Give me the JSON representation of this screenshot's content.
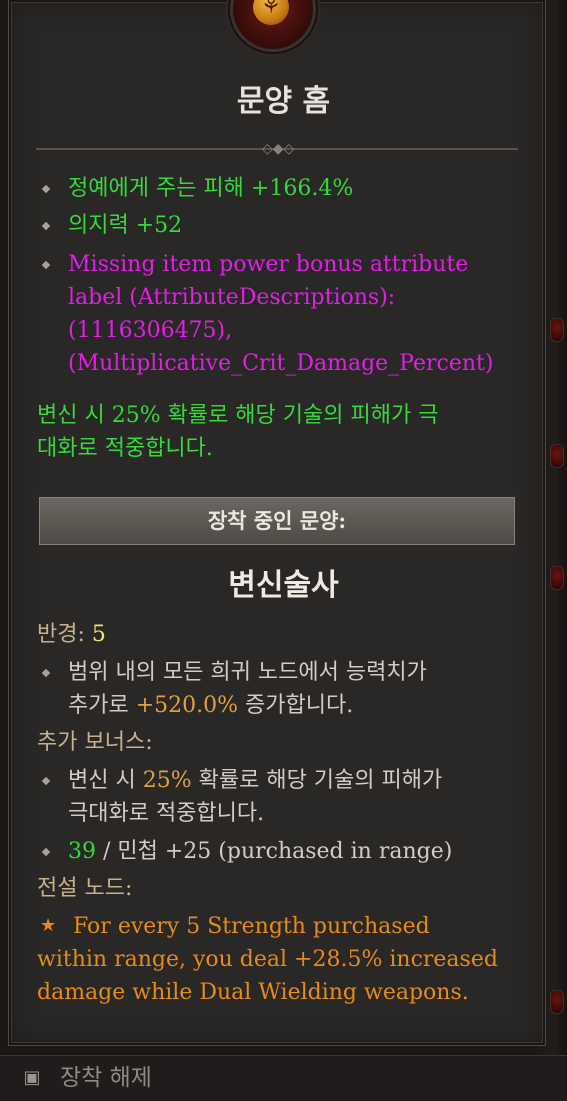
{
  "tooltip": {
    "title": "문양 홈",
    "bonuses": [
      "정예에게 주는 피해 +166.4%",
      "의지력 +52"
    ],
    "missing_line_1": "Missing item power bonus attribute",
    "missing_line_2": "label (AttributeDescriptions):",
    "missing_line_3": "(1116306475),",
    "missing_line_4": "(Multiplicative_Crit_Damage_Percent)",
    "effect_line_1": "변신 시 25% 확률로 해당 기술의 피해가 극",
    "effect_line_2": "대화로 적중합니다.",
    "equipped_glyph_label": "장착 중인 문양:",
    "glyph_name": "변신술사",
    "radius_label": "반경:",
    "radius_value": "5",
    "node_bonus_line_1": "범위 내의 모든 희귀 노드에서 능력치가",
    "node_bonus_line_2a": "추가로 ",
    "node_bonus_value": "+520.0%",
    "node_bonus_line_2b": " 증가합니다.",
    "additional_bonus_label": "추가 보너스:",
    "additional_line_1a": "변신 시 ",
    "additional_value": "25%",
    "additional_line_1b": " 확률로 해당 기술의 피해가",
    "additional_line_2": "극대화로 적중합니다.",
    "purchased_value": "39",
    "purchased_text": " / 민첩 +25 (purchased in range)",
    "legendary_node_label": "전설 노드:",
    "legendary_line_1": "For every 5 Strength purchased",
    "legendary_line_2": "within range, you deal +28.5% increased",
    "legendary_line_3": "damage while Dual Wielding weapons."
  },
  "bottom_bar": {
    "unequip_label": "장착 해제"
  },
  "icons": {
    "emblem": "glyph-emblem-icon",
    "unequip": "unequip-icon",
    "star": "star-icon"
  },
  "colors": {
    "bonus_green": "#35d93a",
    "error_magenta": "#e11ee6",
    "legendary_orange": "#e58a1c",
    "radius_yellow": "#f0e469"
  }
}
